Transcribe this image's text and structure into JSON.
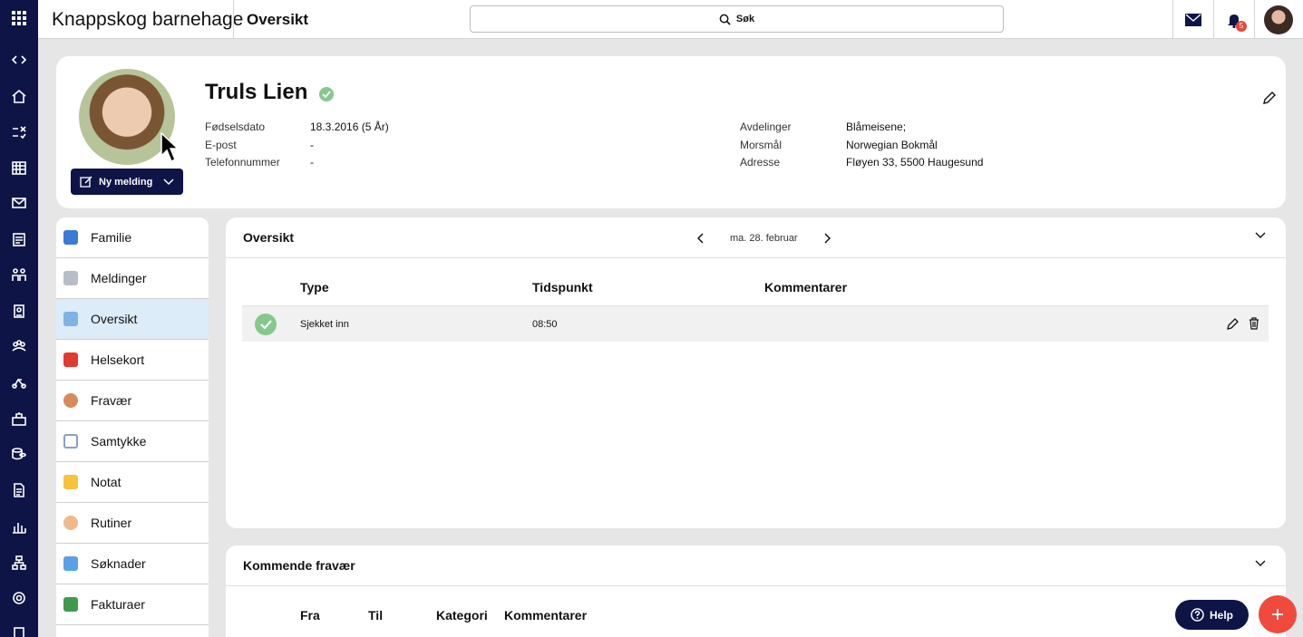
{
  "app": {
    "title": "Knappskog barnehage",
    "crumb": "Oversikt"
  },
  "search": {
    "label": "Søk"
  },
  "notifications": {
    "count": "5"
  },
  "profile": {
    "name": "Truls Lien",
    "new_message_label": "Ny melding",
    "left_fields": [
      {
        "label": "Fødselsdato",
        "value": "18.3.2016 (5 År)"
      },
      {
        "label": "E-post",
        "value": "-"
      },
      {
        "label": "Telefonnummer",
        "value": "-"
      }
    ],
    "right_fields": [
      {
        "label": "Avdelinger",
        "value": "Blåmeisene;"
      },
      {
        "label": "Morsmål",
        "value": "Norwegian Bokmål"
      },
      {
        "label": "Adresse",
        "value": "Fløyen 33, 5500 Haugesund"
      }
    ]
  },
  "sidebar": {
    "items": [
      {
        "label": "Familie",
        "icon": "family-icon",
        "color": "#3a7bd5"
      },
      {
        "label": "Meldinger",
        "icon": "envelope-icon",
        "color": "#b8bec8"
      },
      {
        "label": "Oversikt",
        "icon": "overview-icon",
        "color": "#7fb2e5",
        "active": true
      },
      {
        "label": "Helsekort",
        "icon": "health-card-icon",
        "color": "#e03b30"
      },
      {
        "label": "Fravær",
        "icon": "absence-icon",
        "color": "#d98a5b"
      },
      {
        "label": "Samtykke",
        "icon": "consent-icon",
        "color": "#8aa0c0"
      },
      {
        "label": "Notat",
        "icon": "note-icon",
        "color": "#f7c33d"
      },
      {
        "label": "Rutiner",
        "icon": "routine-icon",
        "color": "#f0b98a"
      },
      {
        "label": "Søknader",
        "icon": "application-icon",
        "color": "#5aa0e6"
      },
      {
        "label": "Fakturaer",
        "icon": "invoice-icon",
        "color": "#3f9a4e"
      }
    ]
  },
  "overview": {
    "title": "Oversikt",
    "date": "ma. 28. februar",
    "columns": [
      "Type",
      "Tidspunkt",
      "Kommentarer"
    ],
    "rows": [
      {
        "type": "Sjekket inn",
        "time": "08:50",
        "comment": ""
      }
    ]
  },
  "absence": {
    "title": "Kommende fravær",
    "columns": [
      "Fra",
      "Til",
      "Kategori",
      "Kommentarer"
    ]
  },
  "help": {
    "label": "Help"
  },
  "colors": {
    "navy": "#0e1446",
    "accent_red": "#ef4a3c",
    "success_green": "#84c98b"
  }
}
